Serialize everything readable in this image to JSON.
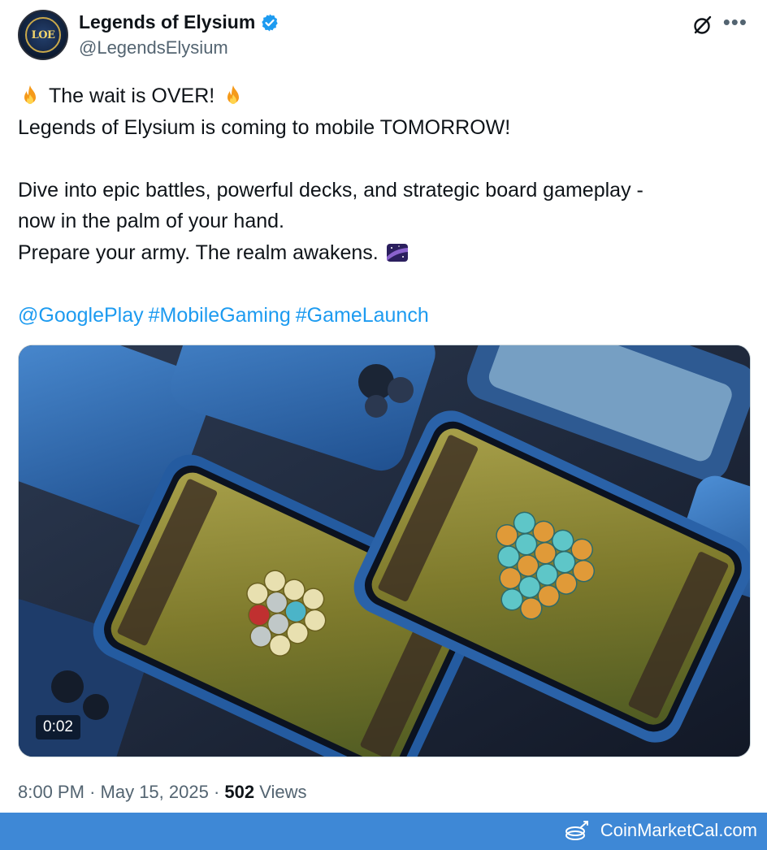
{
  "author": {
    "display_name": "Legends of Elysium",
    "handle": "@LegendsElysium",
    "avatar_text": "LOE",
    "verified": true
  },
  "tweet": {
    "line1": "The wait is OVER!",
    "line2": "Legends of Elysium is coming to mobile TOMORROW!",
    "line3": "Dive into epic battles, powerful decks, and strategic board gameplay -",
    "line4": "now in the palm of your hand.",
    "line5": "Prepare your army. The realm awakens.",
    "mention": "@GooglePlay",
    "hashtag1": "#MobileGaming",
    "hashtag2": "#GameLaunch"
  },
  "media": {
    "duration": "0:02"
  },
  "meta": {
    "time": "8:00 PM",
    "date": "May 15, 2025",
    "separator": "·",
    "views_count": "502",
    "views_label": "Views"
  },
  "footer": {
    "brand": "CoinMarketCal.com"
  },
  "colors": {
    "link": "#1d9bf0",
    "footer_bg": "#3e88d6",
    "text": "#0f1419",
    "muted": "#536471"
  },
  "icons": [
    "verified-badge-icon",
    "grok-icon",
    "more-options-icon",
    "fire-emoji",
    "milky-way-emoji",
    "coinmarketcal-logo-icon"
  ]
}
